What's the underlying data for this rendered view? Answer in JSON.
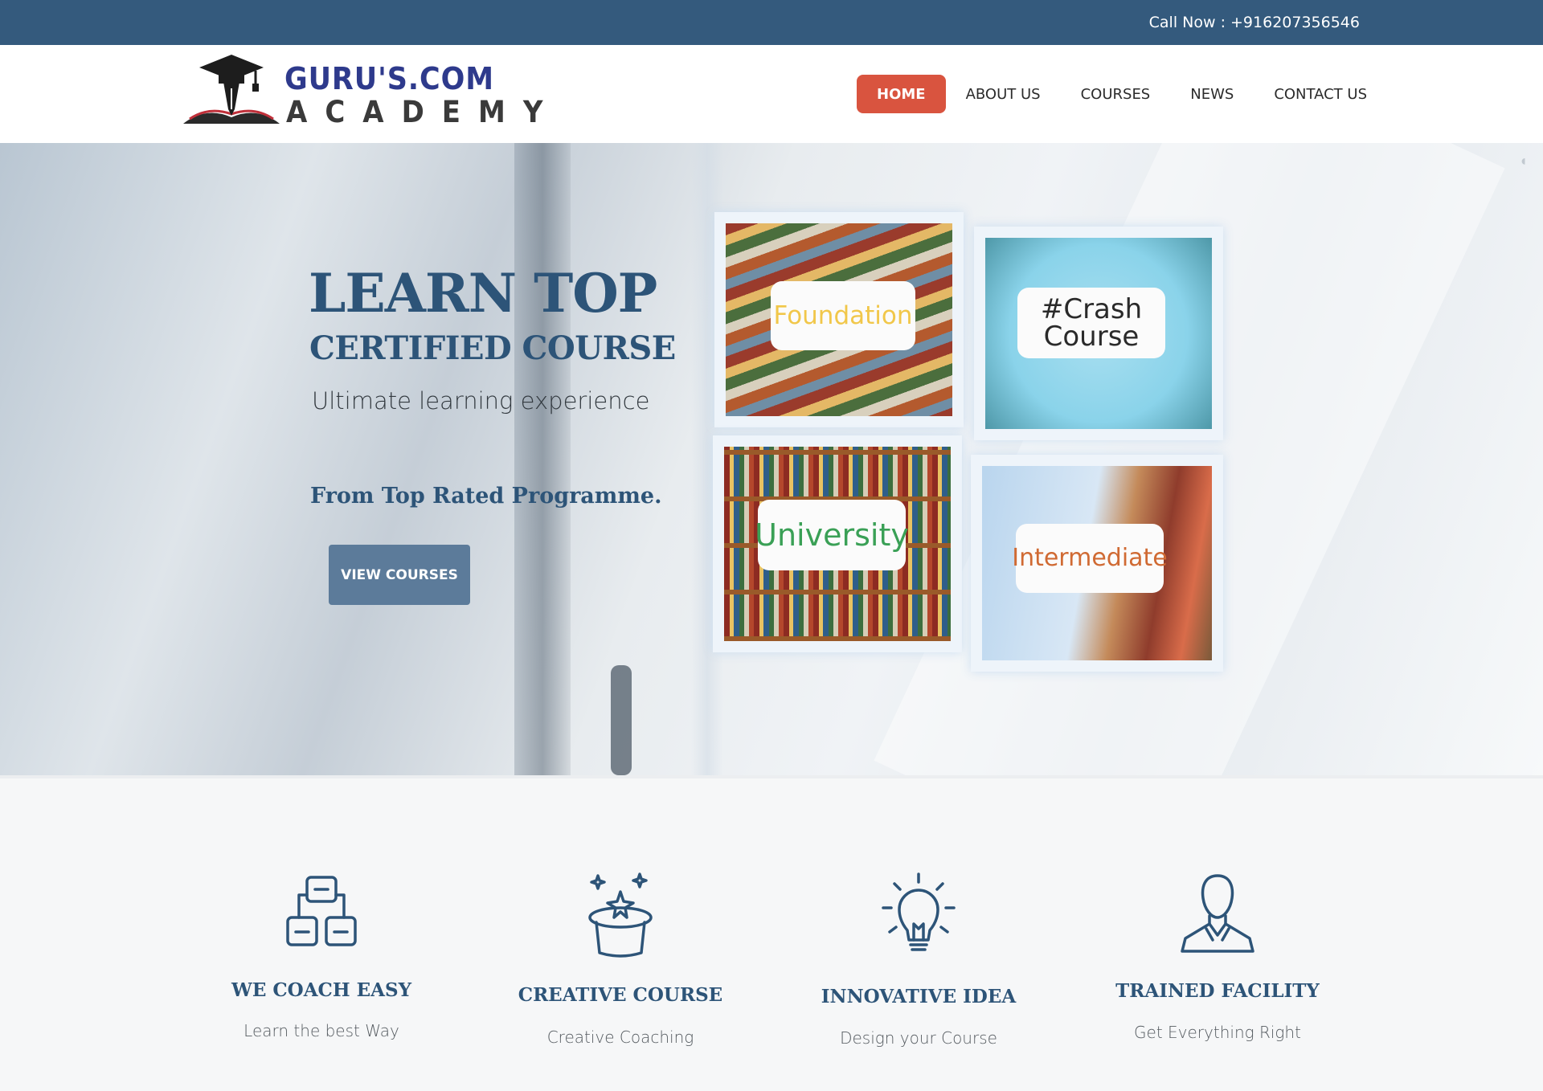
{
  "topbar": {
    "call_text": "Call Now : +916207356546"
  },
  "logo": {
    "line1": "GURU'S.COM",
    "line2": "ACADEMY"
  },
  "nav": {
    "items": [
      {
        "label": "HOME",
        "active": true
      },
      {
        "label": "ABOUT US"
      },
      {
        "label": "COURSES"
      },
      {
        "label": "NEWS"
      },
      {
        "label": "CONTACT US"
      }
    ]
  },
  "hero": {
    "title_line1": "LEARN TOP",
    "title_line2": "CERTIFIED COURSE",
    "subtitle": "Ultimate learning experience",
    "tagline": "From Top Rated Programme.",
    "button_label": "VIEW COURSES",
    "tiles": [
      {
        "label": "Foundation"
      },
      {
        "label": "#Crash\nCourse"
      },
      {
        "label": "University"
      },
      {
        "label": "Intermediate"
      }
    ]
  },
  "features": [
    {
      "icon": "hierarchy-icon",
      "title": "WE COACH EASY",
      "desc": "Learn the best Way"
    },
    {
      "icon": "magic-hat-icon",
      "title": "CREATIVE COURSE",
      "desc": "Creative Coaching"
    },
    {
      "icon": "lightbulb-icon",
      "title": "INNOVATIVE IDEA",
      "desc": "Design your Course"
    },
    {
      "icon": "person-icon",
      "title": "TRAINED FACILITY",
      "desc": "Get Everything Right"
    }
  ],
  "colors": {
    "brand": "#345a7d",
    "accent": "#d9543f",
    "button": "#5c7b9a",
    "heading": "#2d5478"
  }
}
